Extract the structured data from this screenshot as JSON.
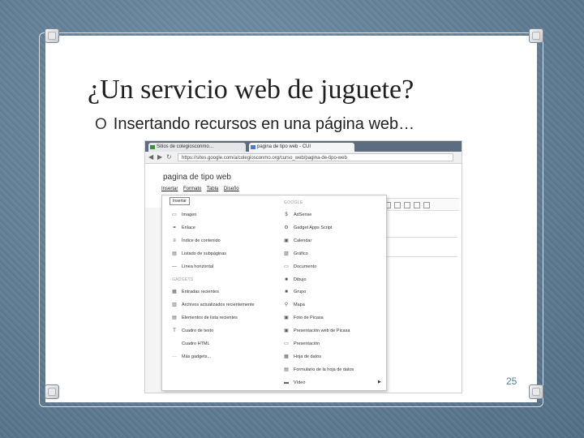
{
  "slide": {
    "title": "¿Un servicio web de juguete?",
    "bullet_marker": "O",
    "bullet_text": "Insertando recursos en una página web…",
    "page_number": "25"
  },
  "browser": {
    "tab_title": "Sitios de colegiosconmo…",
    "tab2_title": "pagina de tipo web - CUI",
    "address": "https://sites.google.com/a/colegiosconmo.org/curso_web/pagina-de-tipo-web",
    "back_icon": "arrow-left-icon",
    "forward_icon": "arrow-right-icon",
    "reload_icon": "reload-icon"
  },
  "page": {
    "title": "pagina de tipo web",
    "menu": [
      "Insertar",
      "Formato",
      "Tabla",
      "Diseño"
    ],
    "tooltip": "Insertar"
  },
  "dropdown": {
    "left_section_common": "",
    "left_items": [
      {
        "icon": "▭",
        "icon_name": "image-icon",
        "label": "Imagen"
      },
      {
        "icon": "⚭",
        "icon_name": "link-icon",
        "label": "Enlace"
      },
      {
        "icon": "≡",
        "icon_name": "toc-icon",
        "label": "Índice de contenido"
      },
      {
        "icon": "▤",
        "icon_name": "subpages-icon",
        "label": "Listado de subpáginas"
      },
      {
        "icon": "—",
        "icon_name": "hr-icon",
        "label": "Línea horizontal"
      }
    ],
    "left_section_gadgets": "GADGETS",
    "left_gadgets": [
      {
        "icon": "▦",
        "icon_name": "recent-posts-icon",
        "label": "Entradas recientes"
      },
      {
        "icon": "▥",
        "icon_name": "recent-files-icon",
        "label": "Archivos actualizados recientemente"
      },
      {
        "icon": "▤",
        "icon_name": "recent-list-icon",
        "label": "Elementos de lista recientes"
      },
      {
        "icon": "T",
        "icon_name": "textbox-icon",
        "label": "Cuadro de texto"
      },
      {
        "icon": "",
        "icon_name": "html-icon",
        "label": "Cuadro HTML"
      },
      {
        "icon": "···",
        "icon_name": "more-icon",
        "label": "Más gadgets..."
      }
    ],
    "right_section_google": "GOOGLE",
    "right_items": [
      {
        "icon": "$",
        "icon_name": "adsense-icon",
        "label": "AdSense"
      },
      {
        "icon": "⚙",
        "icon_name": "apps-script-icon",
        "label": "Gadget Apps Script"
      },
      {
        "icon": "▣",
        "icon_name": "calendar-icon",
        "label": "Calendar"
      },
      {
        "icon": "▨",
        "icon_name": "chart-icon",
        "label": "Gráfico"
      },
      {
        "icon": "▭",
        "icon_name": "document-icon",
        "label": "Documento"
      },
      {
        "icon": "■",
        "icon_name": "drawing-icon",
        "label": "Dibujo"
      },
      {
        "icon": "■",
        "icon_name": "groups-icon",
        "label": "Grupo"
      },
      {
        "icon": "⚲",
        "icon_name": "map-icon",
        "label": "Mapa"
      },
      {
        "icon": "▣",
        "icon_name": "picasa-photo-icon",
        "label": "Foto de Picasa"
      },
      {
        "icon": "▣",
        "icon_name": "picasa-slideshow-icon",
        "label": "Presentación web de Picasa"
      },
      {
        "icon": "▭",
        "icon_name": "presentation-icon",
        "label": "Presentación"
      },
      {
        "icon": "▦",
        "icon_name": "spreadsheet-icon",
        "label": "Hoja de datos"
      },
      {
        "icon": "▤",
        "icon_name": "form-icon",
        "label": "Formulario de la hoja de datos"
      },
      {
        "icon": "▬",
        "icon_name": "video-icon",
        "label": "Vídeo",
        "arrow": "▶"
      }
    ]
  }
}
